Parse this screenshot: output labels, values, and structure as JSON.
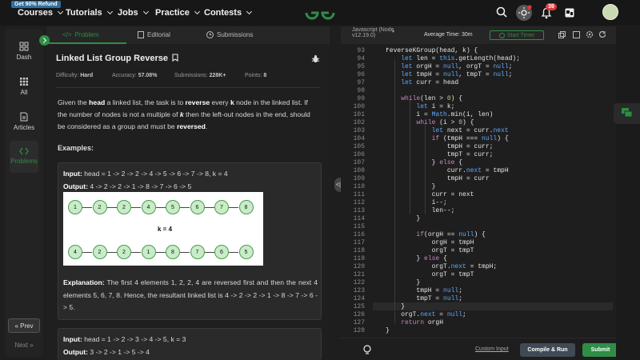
{
  "topnav": {
    "promo": "Get 90% Refund",
    "items": [
      "Courses",
      "Tutorials",
      "Jobs",
      "Practice",
      "Contests"
    ],
    "notifications_count": "39"
  },
  "sidebar": {
    "items": [
      "Dash",
      "All",
      "Articles",
      "Problems"
    ],
    "prev_label": "Prev",
    "next_label": "Next"
  },
  "problem": {
    "tabs": [
      "Problem",
      "Editorial",
      "Submissions"
    ],
    "title": "Linked List Group Reverse",
    "difficulty_label": "Difficulty:",
    "difficulty": "Hard",
    "accuracy_label": "Accuracy:",
    "accuracy": "57.08%",
    "submissions_label": "Submissions:",
    "submissions": "228K+",
    "points_label": "Points:",
    "points": "8",
    "examples_heading": "Examples:",
    "example1": {
      "input": "head = 1 -> 2 -> 2 -> 4 -> 5 -> 6 -> 7 -> 8, k = 4",
      "output": "4 -> 2 -> 2 -> 1 -> 8 -> 7 -> 6 -> 5",
      "k_label": "k = 4",
      "row1": [
        "1",
        "2",
        "2",
        "4",
        "5",
        "6",
        "7",
        "8"
      ],
      "row2": [
        "4",
        "2",
        "2",
        "1",
        "8",
        "7",
        "6",
        "5"
      ]
    },
    "example2": {
      "input": "head = 1 -> 2 -> 3 -> 4 -> 5, k = 3",
      "output": "3 -> 2 -> 1 -> 5 -> 4"
    },
    "labels": {
      "input": "Input:",
      "output": "Output:",
      "explanation": "Explanation:"
    }
  },
  "editor": {
    "language": "Javascript (Node v12.19.0)",
    "avg_time": "Average Time: 30m",
    "start_timer": "Start Timer",
    "custom_input": "Custom Input",
    "compile_run": "Compile & Run",
    "submit": "Submit",
    "line_numbers": [
      "93",
      "94",
      "95",
      "96",
      "97",
      "98",
      "99",
      "100",
      "101",
      "102",
      "103",
      "104",
      "105",
      "106",
      "107",
      "108",
      "109",
      "110",
      "111",
      "112",
      "113",
      "114",
      "115",
      "116",
      "117",
      "118",
      "119",
      "120",
      "121",
      "122",
      "123",
      "124",
      "125",
      "126",
      "127",
      "128"
    ]
  },
  "colors": {
    "accent": "#2f8d46",
    "background": "#1e1e1e"
  }
}
